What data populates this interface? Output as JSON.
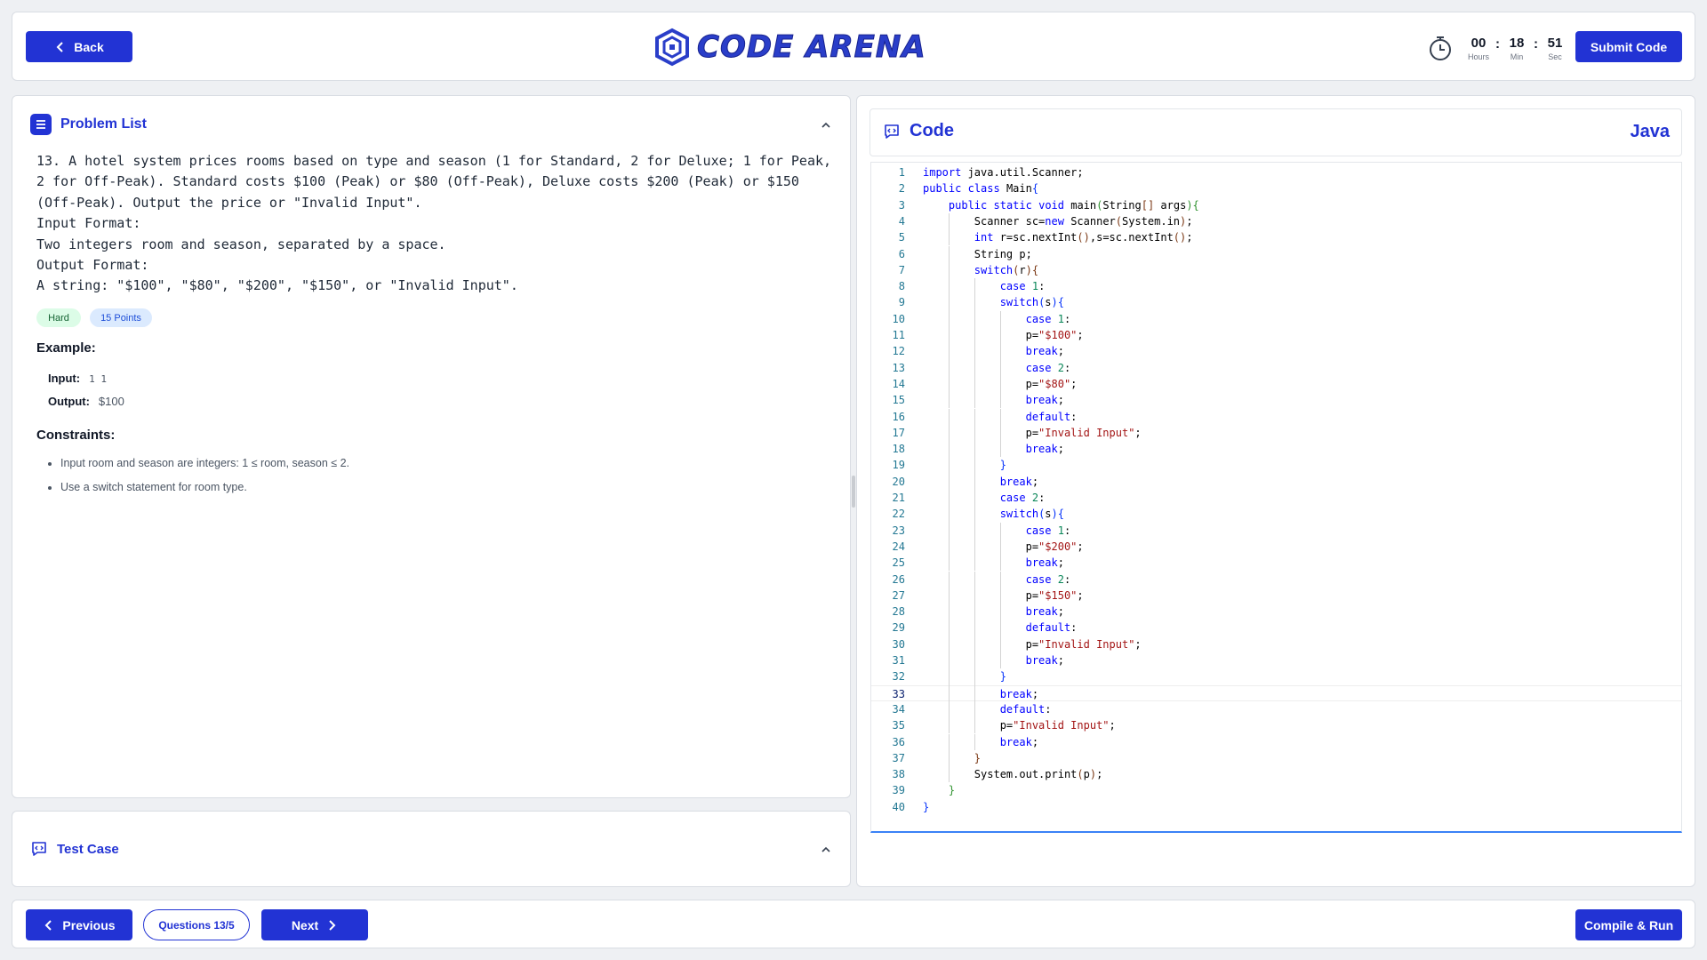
{
  "header": {
    "back_label": "Back",
    "logo_text": "CODE ARENA",
    "timer": {
      "hours": "00",
      "minutes": "18",
      "seconds": "51",
      "hours_label": "Hours",
      "minutes_label": "Min",
      "seconds_label": "Sec",
      "separator": ":"
    },
    "submit_label": "Submit Code"
  },
  "problem": {
    "title": "Problem List",
    "statement": "13. A hotel system prices rooms based on type and season (1 for Standard, 2 for Deluxe; 1 for Peak, 2 for Off-Peak). Standard costs $100 (Peak) or $80 (Off-Peak), Deluxe costs $200 (Peak) or $150 (Off-Peak). Output the price or \"Invalid Input\".\nInput Format:\nTwo integers room and season, separated by a space.\nOutput Format:\nA string: \"$100\", \"$80\", \"$200\", \"$150\", or \"Invalid Input\".",
    "difficulty": "Hard",
    "points": "15 Points",
    "example_title": "Example:",
    "example_input_label": "Input:",
    "example_input": "1 1",
    "example_output_label": "Output:",
    "example_output": "$100",
    "constraints_title": "Constraints:",
    "constraints": [
      "Input room and season are integers: 1 ≤ room, season ≤ 2.",
      "Use a switch statement for room type."
    ]
  },
  "testcase": {
    "title": "Test Case"
  },
  "code_panel": {
    "title": "Code",
    "language": "Java",
    "active_line": 33,
    "lines": [
      "import java.util.Scanner;",
      "public class Main{",
      "    public static void main(String[] args){",
      "        Scanner sc=new Scanner(System.in);",
      "        int r=sc.nextInt(),s=sc.nextInt();",
      "        String p;",
      "        switch(r){",
      "            case 1:",
      "            switch(s){",
      "                case 1:",
      "                p=\"$100\";",
      "                break;",
      "                case 2:",
      "                p=\"$80\";",
      "                break;",
      "                default:",
      "                p=\"Invalid Input\";",
      "                break;",
      "            }",
      "            break;",
      "            case 2:",
      "            switch(s){",
      "                case 1:",
      "                p=\"$200\";",
      "                break;",
      "                case 2:",
      "                p=\"$150\";",
      "                break;",
      "                default:",
      "                p=\"Invalid Input\";",
      "                break;",
      "            }",
      "            break;",
      "            default:",
      "            p=\"Invalid Input\";",
      "            break;",
      "        }",
      "        System.out.print(p);",
      "    }",
      "}"
    ]
  },
  "footer": {
    "previous_label": "Previous",
    "questions_label": "Questions 13/5",
    "next_label": "Next",
    "run_label": "Compile & Run"
  },
  "colors": {
    "accent": "#2233d4",
    "background": "#eef0f3",
    "badge_hard": "#dcfce7",
    "badge_points": "#dbeafe"
  },
  "icons": [
    "chevron-left-icon",
    "logo-emblem-icon",
    "lightning-icon",
    "stopwatch-icon",
    "list-icon",
    "chevron-up-icon",
    "code-bubble-icon",
    "chevron-right-icon"
  ]
}
